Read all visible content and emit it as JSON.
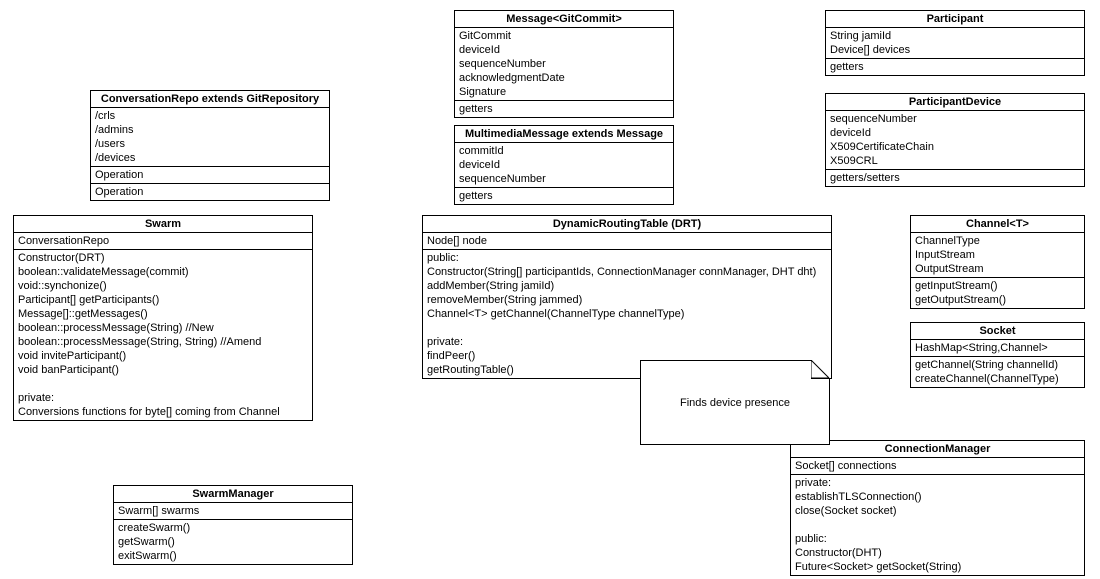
{
  "classes": {
    "conversationRepo": {
      "title": "ConversationRepo extends GitRepository",
      "attrs": [
        "/crls",
        "/admins",
        "/users",
        "/devices"
      ],
      "ops1": [
        "Operation"
      ],
      "ops2": [
        "Operation"
      ]
    },
    "message": {
      "title": "Message<GitCommit>",
      "attrs": [
        "GitCommit",
        "deviceId",
        "sequenceNumber",
        "acknowledgmentDate",
        "Signature"
      ],
      "ops": [
        "getters"
      ]
    },
    "participant": {
      "title": "Participant",
      "attrs": [
        "String jamiId",
        "Device[] devices"
      ],
      "ops": [
        "getters"
      ]
    },
    "multimediaMessage": {
      "title": "MultimediaMessage extends Message",
      "attrs": [
        "commitId",
        "deviceId",
        "sequenceNumber"
      ],
      "ops": [
        "getters"
      ]
    },
    "participantDevice": {
      "title": "ParticipantDevice",
      "attrs": [
        "sequenceNumber",
        "deviceId",
        "X509CertificateChain",
        "X509CRL"
      ],
      "ops": [
        "getters/setters"
      ]
    },
    "swarm": {
      "title": "Swarm",
      "attrs": [
        "ConversationRepo"
      ],
      "ops": [
        "Constructor(DRT)",
        "boolean::validateMessage(commit)",
        "void::synchonize()",
        "Participant[] getParticipants()",
        "Message[]::getMessages()",
        "boolean::processMessage(String)  //New",
        "boolean::processMessage(String, String)  //Amend",
        "void inviteParticipant()",
        "void banParticipant()",
        "",
        "private:",
        "Conversions functions for byte[] coming from Channel"
      ]
    },
    "drt": {
      "title": "DynamicRoutingTable (DRT)",
      "attrs": [
        "Node[] node"
      ],
      "ops": [
        "public:",
        "Constructor(String[] participantIds, ConnectionManager connManager, DHT dht)",
        "addMember(String jamiId)",
        "removeMember(String jammed)",
        "Channel<T> getChannel(ChannelType channelType)",
        "",
        "private:",
        "findPeer()",
        "getRoutingTable()"
      ]
    },
    "channel": {
      "title": "Channel<T>",
      "attrs": [
        "ChannelType",
        "InputStream",
        "OutputStream"
      ],
      "ops": [
        "getInputStream()",
        "getOutputStream()"
      ]
    },
    "socket": {
      "title": "Socket",
      "attrs": [
        "HashMap<String,Channel>"
      ],
      "ops": [
        "getChannel(String channelId)",
        "createChannel(ChannelType)"
      ]
    },
    "swarmManager": {
      "title": "SwarmManager",
      "attrs": [
        "Swarm[] swarms"
      ],
      "ops": [
        "createSwarm()",
        "getSwarm()",
        "exitSwarm()"
      ]
    },
    "connectionManager": {
      "title": "ConnectionManager",
      "attrs": [
        "Socket[] connections"
      ],
      "ops": [
        "private:",
        "establishTLSConnection()",
        "close(Socket socket)",
        "",
        "public:",
        "Constructor(DHT)",
        "Future<Socket> getSocket(String)"
      ]
    }
  },
  "note": {
    "text": "Finds device presence"
  }
}
